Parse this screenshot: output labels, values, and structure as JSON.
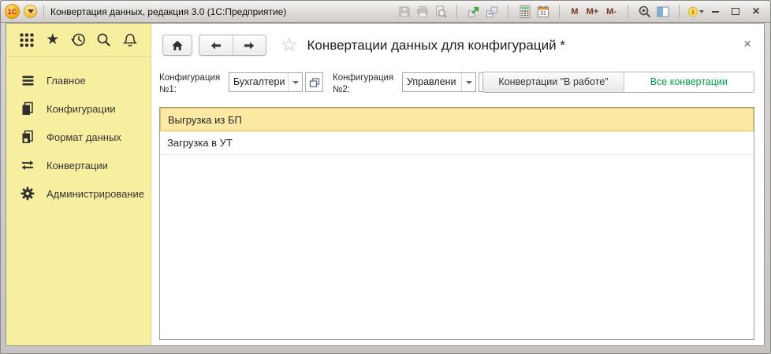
{
  "window": {
    "title": "Конвертация данных, редакция 3.0  (1С:Предприятие)",
    "logo_text": "1С",
    "toolbar": {
      "calendar_day": "31",
      "m": "M",
      "m_plus": "M+",
      "m_minus": "M-"
    },
    "controls": {
      "close": "×"
    }
  },
  "sidebar": {
    "items": [
      {
        "label": "Главное",
        "icon": "menu"
      },
      {
        "label": "Конфигурации",
        "icon": "documents"
      },
      {
        "label": "Формат данных",
        "icon": "data-format"
      },
      {
        "label": "Конвертации",
        "icon": "swap-arrows"
      },
      {
        "label": "Администрирование",
        "icon": "gear"
      }
    ]
  },
  "main": {
    "favorite_star": "☆",
    "page_title": "Конвертации данных для конфигураций *",
    "close": "×",
    "form": {
      "config1_label": "Конфигурация №1:",
      "config1_value": "Бухгалтери",
      "config2_label": "Конфигурация №2:",
      "config2_value": "Управлени",
      "filter_buttons": [
        {
          "label": "Конвертации \"В работе\"",
          "active": false
        },
        {
          "label": "Все конвертации",
          "active": true
        }
      ]
    },
    "list": {
      "rows": [
        {
          "label": "Выгрузка из БП",
          "selected": true
        },
        {
          "label": "Загрузка в УТ",
          "selected": false
        }
      ]
    }
  },
  "colors": {
    "sidebar_bg": "#f8ee9f",
    "selection_bg": "#fce9a4",
    "selection_border": "#e8c052",
    "accent_green": "#00a44a"
  }
}
